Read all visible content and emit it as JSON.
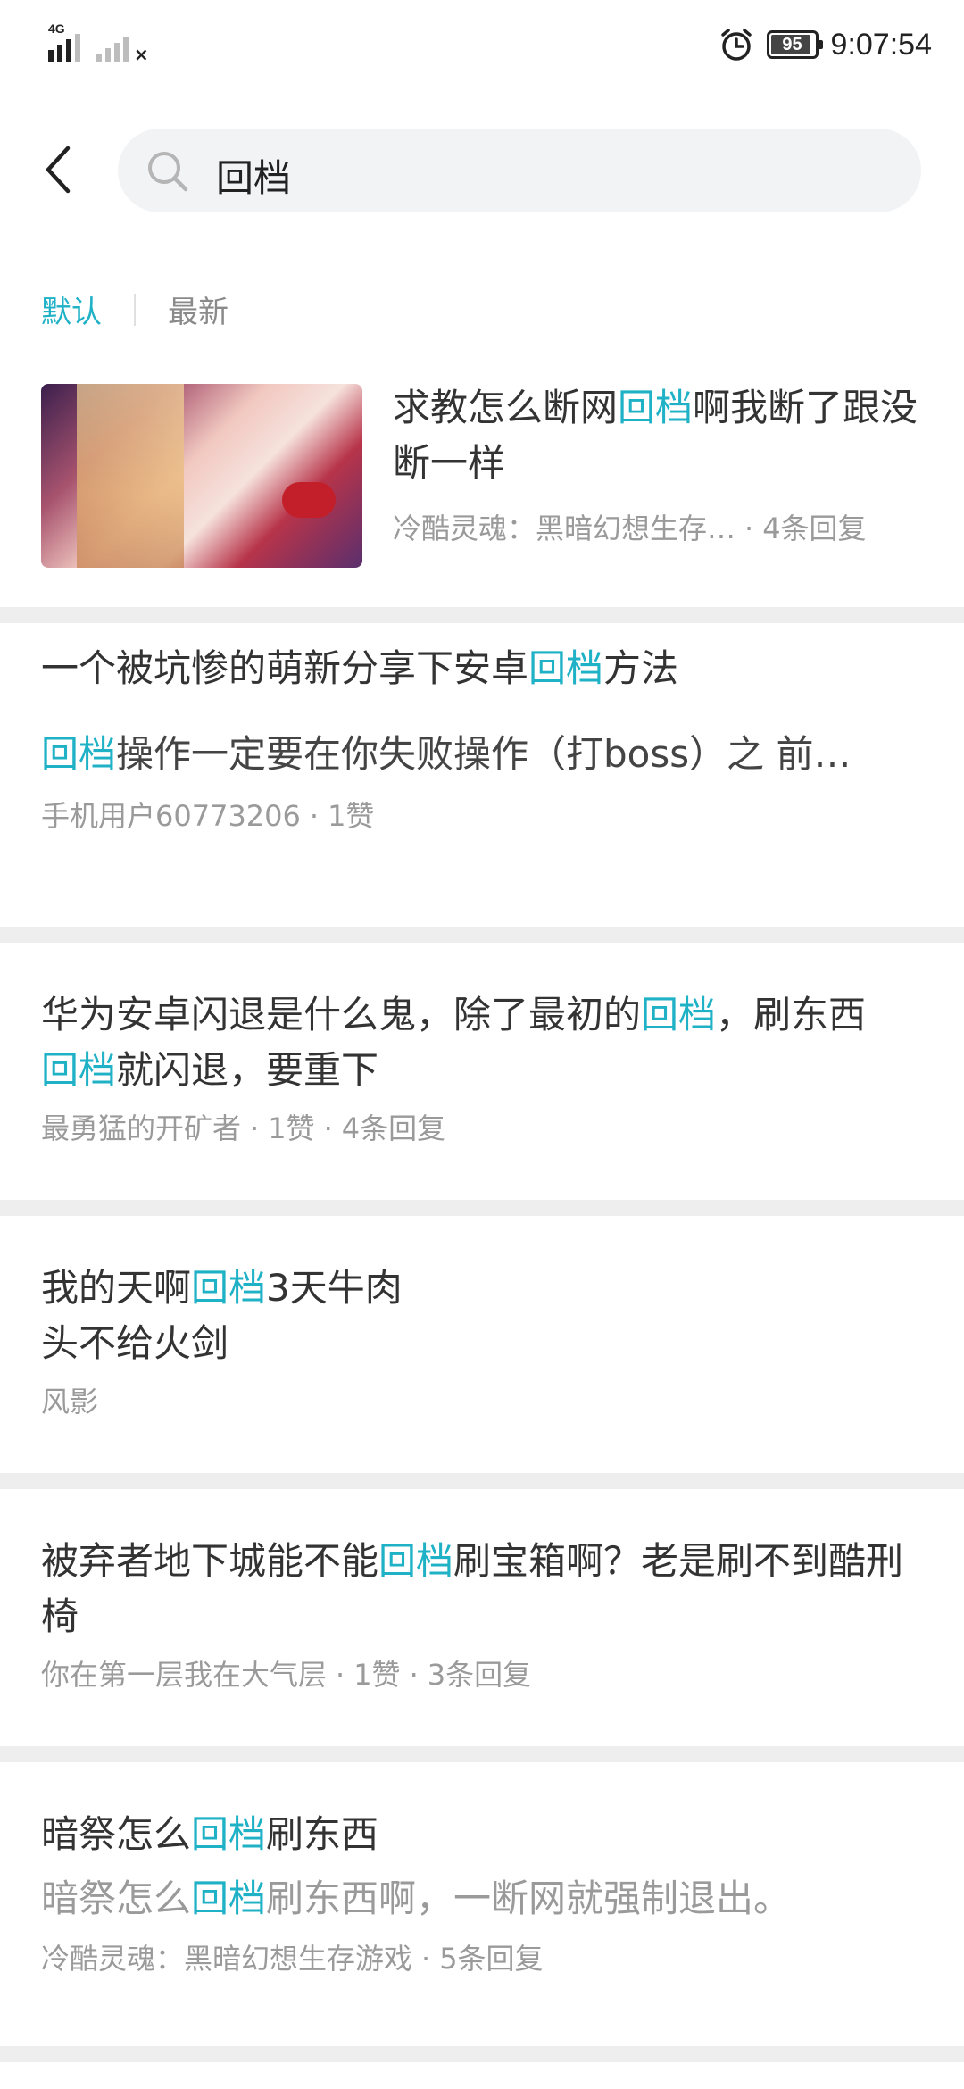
{
  "status_bar": {
    "network_label": "4G",
    "battery": "95",
    "time": "9:07:54"
  },
  "search": {
    "query": "回档"
  },
  "tabs": [
    {
      "label": "默认",
      "active": true
    },
    {
      "label": "最新",
      "active": false
    }
  ],
  "results": [
    {
      "title_parts": [
        "求教怎么断网",
        "回档",
        "啊我断了跟没断一样"
      ],
      "meta_author": "冷酷灵魂：黑暗幻想生存…",
      "meta_replies": "4条回复",
      "has_thumbnail": true
    },
    {
      "title_parts": [
        "一个被坑惨的萌新分享下安卓",
        "回档",
        "方法"
      ],
      "body_parts": [
        "回档",
        "操作一定要在你失败操作（打boss）之  前…"
      ],
      "meta_author": "手机用户60773206",
      "meta_likes": "1赞"
    },
    {
      "title_parts": [
        "华为安卓闪退是什么鬼，除了最初的",
        "回档",
        "，刷东西",
        "回档",
        "就闪退，要重下"
      ],
      "meta_author": "最勇猛的开矿者",
      "meta_likes": "1赞",
      "meta_replies": "4条回复"
    },
    {
      "title_parts": [
        "我的天啊",
        "回档",
        "3天牛肉",
        "头不给火剑"
      ],
      "meta_author": "风影"
    },
    {
      "title_parts": [
        "被弃者地下城能不能",
        "回档",
        "刷宝箱啊？老是刷不到酷刑椅"
      ],
      "meta_author": "你在第一层我在大气层",
      "meta_likes": "1赞",
      "meta_replies": "3条回复"
    },
    {
      "title_parts": [
        "暗祭怎么",
        "回档",
        "刷东西"
      ],
      "body_parts": [
        "暗祭怎么",
        "回档",
        "刷东西啊，一断网就强制退出。"
      ],
      "meta_author": "冷酷灵魂：黑暗幻想生存游戏",
      "meta_replies": "5条回复"
    }
  ],
  "colors": {
    "highlight": "#1fb1c6",
    "meta_text": "#9a9a9a",
    "divider": "#eeeeee"
  }
}
